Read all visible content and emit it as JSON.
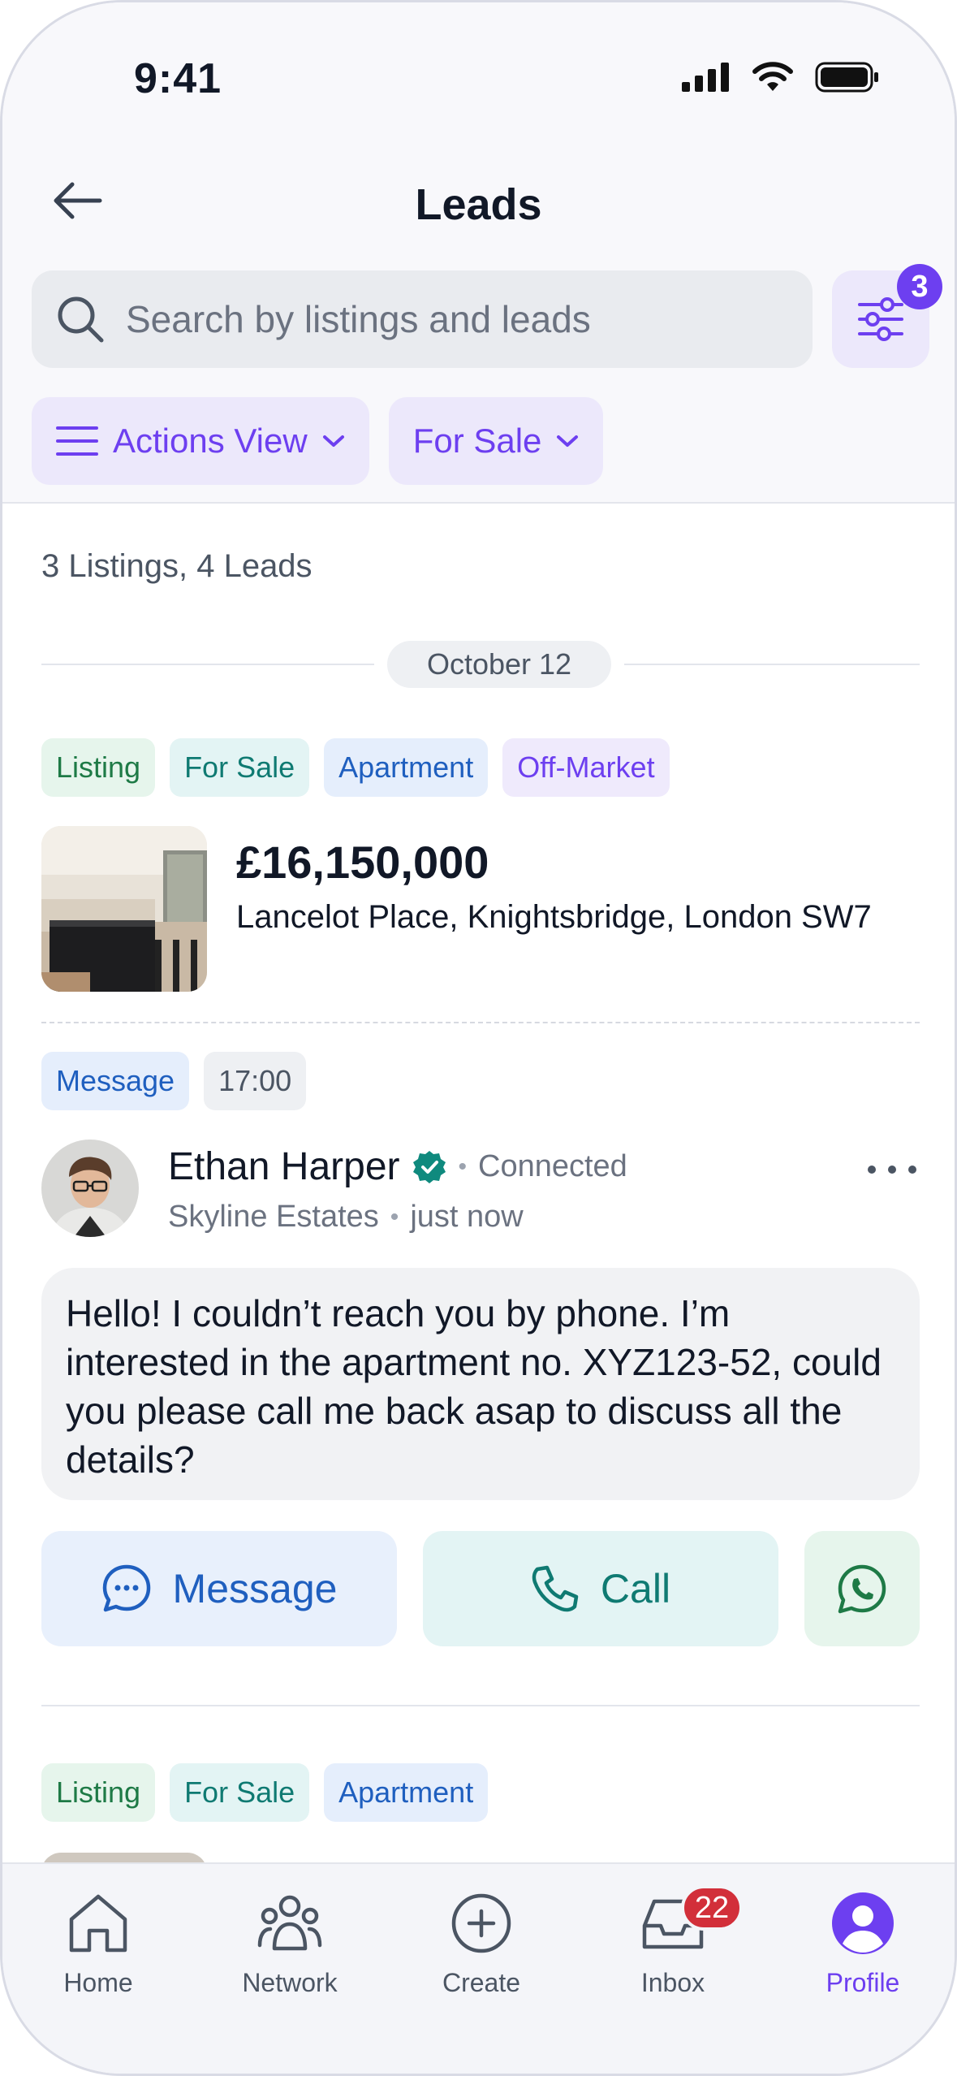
{
  "status": {
    "time": "9:41"
  },
  "header": {
    "title": "Leads"
  },
  "search": {
    "placeholder": "Search by listings and leads"
  },
  "filter": {
    "badge": "3"
  },
  "chips": {
    "view": "Actions View",
    "type": "For Sale"
  },
  "summary": "3 Listings, 4 Leads",
  "date": "October 12",
  "listing1": {
    "tags": [
      "Listing",
      "For Sale",
      "Apartment",
      "Off-Market"
    ],
    "price": "£16,150,000",
    "address": "Lancelot Place, Knightsbridge, London SW7"
  },
  "lead": {
    "tags": [
      "Message",
      "17:00"
    ],
    "name": "Ethan Harper",
    "status": "Connected",
    "company": "Skyline Estates",
    "time": "just now",
    "message": "Hello! I couldn’t reach you by phone. I’m interested in the apartment no. XYZ123-52, could you please call me back asap to discuss all the details?"
  },
  "actions": {
    "message": "Message",
    "call": "Call"
  },
  "listing2": {
    "tags": [
      "Listing",
      "For Sale",
      "Apartment"
    ]
  },
  "nav": {
    "home": "Home",
    "network": "Network",
    "create": "Create",
    "inbox": "Inbox",
    "inbox_badge": "22",
    "profile": "Profile"
  },
  "colors": {
    "accent": "#6d3ff0",
    "badge_red": "#d22f3a",
    "verified": "#0f8a7e"
  }
}
